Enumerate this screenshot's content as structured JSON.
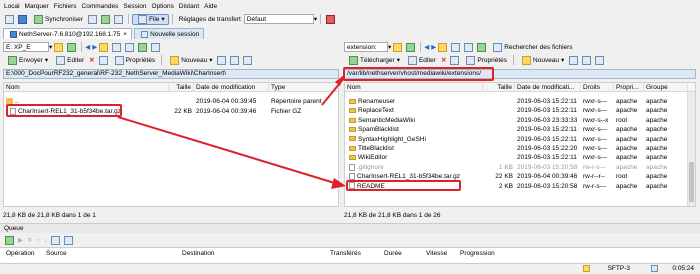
{
  "menu": [
    "Local",
    "Marquer",
    "Fichiers",
    "Commandes",
    "Session",
    "Options",
    "Distant",
    "Aide"
  ],
  "toolbar": {
    "sync_label": "Synchroniser",
    "queue_label": "File",
    "transfer_settings_label": "Réglages de transfert",
    "transfer_settings_value": "Défaut"
  },
  "tabs": [
    {
      "label": "NethServer-7.6.810@192.168.1.75"
    },
    {
      "label": "Nouvelle session"
    }
  ],
  "left": {
    "drive": "E: XP_E",
    "toolbar": {
      "send": "Envoyer",
      "edit": "Editer",
      "props": "Propriétés",
      "new": "Nouveau"
    },
    "path": "E:\\000_DocPourRF232_general\\RF-232_NethServer_MediaWiki\\CharInsert\\",
    "columns": [
      "Nom",
      "Taille",
      "Date de modification",
      "Type"
    ],
    "rows": [
      {
        "name": "..",
        "size": "",
        "date": "2019-06-04 00:39:45",
        "type": "Répertoire parent",
        "kind": "up"
      },
      {
        "name": "CharInsert-REL1_31-b5f34be.tar.gz",
        "size": "22 KB",
        "date": "2019-06-04 00:39:46",
        "type": "Fichier GZ",
        "kind": "file"
      }
    ],
    "status": "21,8 KB de 21,8 KB dans 1 de 1"
  },
  "right": {
    "drive": "extension:",
    "toolbar": {
      "download": "Télécharger",
      "edit": "Editer",
      "props": "Propriétés",
      "new": "Nouveau",
      "find": "Rechercher des fichiers"
    },
    "path": "/var/lib/nethserver/vhost/mediawiki/extensions/",
    "columns": [
      "Nom",
      "Taille",
      "Date de modificati...",
      "Droits",
      "Propri...",
      "Groupe"
    ],
    "rows": [
      {
        "name": "Renameuser",
        "size": "",
        "date": "2019-06-03 15:22:11",
        "rights": "rwxr-s---",
        "owner": "apache",
        "group": "apache",
        "kind": "folder"
      },
      {
        "name": "ReplaceText",
        "size": "",
        "date": "2019-06-03 15:22:11",
        "rights": "rwxr-s---",
        "owner": "apache",
        "group": "apache",
        "kind": "folder"
      },
      {
        "name": "SemanticMediaWiki",
        "size": "",
        "date": "2019-06-03 23:33:33",
        "rights": "rwxr-s--x",
        "owner": "root",
        "group": "apache",
        "kind": "folder"
      },
      {
        "name": "SpamBlacklist",
        "size": "",
        "date": "2019-06-03 15:22:11",
        "rights": "rwxr-s---",
        "owner": "apache",
        "group": "apache",
        "kind": "folder"
      },
      {
        "name": "SyntaxHighlight_GeSHi",
        "size": "",
        "date": "2019-06-03 15:22:11",
        "rights": "rwxr-s---",
        "owner": "apache",
        "group": "apache",
        "kind": "folder"
      },
      {
        "name": "TitleBlacklist",
        "size": "",
        "date": "2019-06-03 15:22:20",
        "rights": "rwxr-s---",
        "owner": "apache",
        "group": "apache",
        "kind": "folder"
      },
      {
        "name": "WikiEditor",
        "size": "",
        "date": "2019-06-03 15:22:11",
        "rights": "rwxr-s---",
        "owner": "apache",
        "group": "apache",
        "kind": "folder"
      },
      {
        "name": ".gitignore",
        "size": "1 KB",
        "date": "2019-06-03 15:20:58",
        "rights": "rw-r-s---",
        "owner": "apache",
        "group": "apache",
        "kind": "file",
        "dim": true
      },
      {
        "name": "CharInsert-REL1_31-b5f34be.tar.gz",
        "size": "22 KB",
        "date": "2019-06-04 00:39:46",
        "rights": "rw-r--r--",
        "owner": "root",
        "group": "apache",
        "kind": "file"
      },
      {
        "name": "README",
        "size": "2 KB",
        "date": "2019-06-03 15:20:58",
        "rights": "rw-r-s---",
        "owner": "apache",
        "group": "apache",
        "kind": "file"
      }
    ],
    "status": "21,8 KB de 21,8 KB dans 1 de 26"
  },
  "queue": {
    "title": "Queue",
    "columns": [
      "Opération",
      "Source",
      "Destination",
      "Transférés",
      "Durée",
      "Vitesse",
      "Progression"
    ]
  },
  "statusbar": {
    "protocol": "SFTP-3",
    "time": "0:05:24"
  },
  "colors": {
    "highlight": "#e0202a",
    "path_bg": "#dce8f6"
  }
}
